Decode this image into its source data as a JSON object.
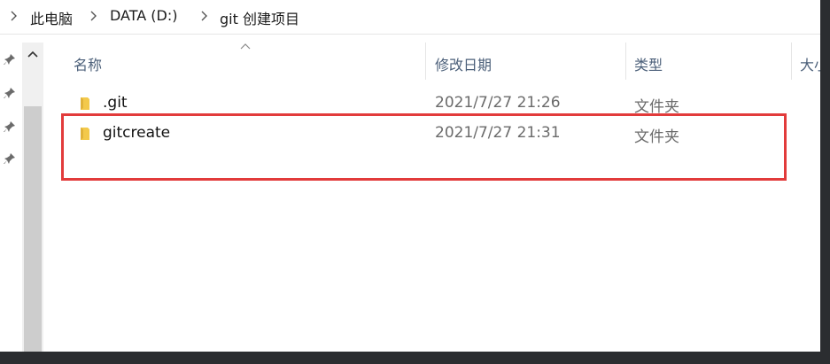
{
  "breadcrumb": {
    "items": [
      "此电脑",
      "DATA (D:)",
      "git 创建项目"
    ]
  },
  "columns": {
    "name": "名称",
    "modified": "修改日期",
    "type": "类型",
    "size": "大小"
  },
  "files": [
    {
      "name": ".git",
      "modified": "2021/7/27 21:26",
      "type": "文件夹",
      "icon": "folder-icon"
    },
    {
      "name": "gitcreate",
      "modified": "2021/7/27 21:31",
      "type": "文件夹",
      "icon": "folder-icon"
    }
  ],
  "colors": {
    "highlight_border": "#e23b3b",
    "folder": "#f3c94b",
    "header_text": "#4c607a",
    "frame": "#2b2d30"
  }
}
